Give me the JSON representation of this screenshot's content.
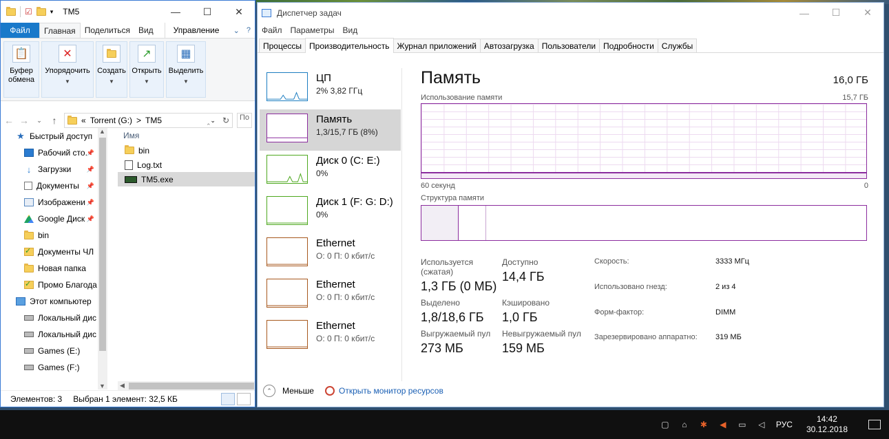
{
  "explorer": {
    "title": "TM5",
    "tabs": {
      "file": "Файл",
      "home": "Главная",
      "share": "Поделиться",
      "view": "Вид",
      "manage": "Управление"
    },
    "ribbon": {
      "clipboard": "Буфер обмена",
      "organize": "Упорядочить",
      "create": "Создать",
      "open": "Открыть",
      "select": "Выделить"
    },
    "address": {
      "prefix": "«",
      "drive": "Torrent (G:)",
      "sep": ">",
      "folder": "TM5",
      "search_placeholder": "По"
    },
    "nav": [
      {
        "label": "Быстрый доступ",
        "icon": "star-icon",
        "pinned": false
      },
      {
        "label": "Рабочий сто.",
        "icon": "desktop-icon",
        "pinned": true
      },
      {
        "label": "Загрузки",
        "icon": "download-icon",
        "pinned": true
      },
      {
        "label": "Документы",
        "icon": "documents-icon",
        "pinned": true
      },
      {
        "label": "Изображени",
        "icon": "pictures-icon",
        "pinned": true
      },
      {
        "label": "Google Диск",
        "icon": "google-drive-icon",
        "pinned": true
      },
      {
        "label": "bin",
        "icon": "folder-icon",
        "pinned": false
      },
      {
        "label": "Документы ЧЛ",
        "icon": "folder-check-icon",
        "pinned": false
      },
      {
        "label": "Новая папка",
        "icon": "folder-icon",
        "pinned": false
      },
      {
        "label": "Промо Благода",
        "icon": "folder-check-icon",
        "pinned": false
      },
      {
        "label": "Этот компьютер",
        "icon": "computer-icon",
        "pinned": false
      },
      {
        "label": "Локальный дис",
        "icon": "drive-icon",
        "pinned": false
      },
      {
        "label": "Локальный дис",
        "icon": "drive-icon",
        "pinned": false
      },
      {
        "label": "Games (E:)",
        "icon": "drive-icon",
        "pinned": false
      },
      {
        "label": "Games (F:)",
        "icon": "drive-icon",
        "pinned": false
      }
    ],
    "column_name": "Имя",
    "files": [
      {
        "name": "bin",
        "type": "folder",
        "selected": false
      },
      {
        "name": "Log.txt",
        "type": "txt",
        "selected": false
      },
      {
        "name": "TM5.exe",
        "type": "exe",
        "selected": true
      }
    ],
    "status": {
      "count": "Элементов: 3",
      "selection": "Выбран 1 элемент: 32,5 КБ"
    }
  },
  "taskmgr": {
    "title": "Диспетчер задач",
    "menu": [
      "Файл",
      "Параметры",
      "Вид"
    ],
    "tabs": [
      "Процессы",
      "Производительность",
      "Журнал приложений",
      "Автозагрузка",
      "Пользователи",
      "Подробности",
      "Службы"
    ],
    "active_tab": "Производительность",
    "resources": [
      {
        "name": "ЦП",
        "sub": "2% 3,82 ГГц",
        "color": "#1c7dc1"
      },
      {
        "name": "Память",
        "sub": "1,3/15,7 ГБ (8%)",
        "color": "#8b2c9e"
      },
      {
        "name": "Диск 0 (C: E:)",
        "sub": "0%",
        "color": "#4da81e"
      },
      {
        "name": "Диск 1 (F: G: D:)",
        "sub": "0%",
        "color": "#4da81e"
      },
      {
        "name": "Ethernet",
        "sub": "О: 0 П: 0 кбит/с",
        "color": "#a7581d"
      },
      {
        "name": "Ethernet",
        "sub": "О: 0 П: 0 кбит/с",
        "color": "#a7581d"
      },
      {
        "name": "Ethernet",
        "sub": "О: 0 П: 0 кбит/с",
        "color": "#a7581d"
      }
    ],
    "memory": {
      "title": "Память",
      "total": "16,0 ГБ",
      "usage_caption": "Использование памяти",
      "usage_max": "15,7 ГБ",
      "usage_fraction": 0.08,
      "axis_left": "60 секунд",
      "axis_right": "0",
      "structure_caption": "Структура памяти",
      "stats": {
        "in_use_label": "Используется (сжатая)",
        "in_use": "1,3 ГБ (0 МБ)",
        "available_label": "Доступно",
        "available": "14,4 ГБ",
        "committed_label": "Выделено",
        "committed": "1,8/18,6 ГБ",
        "cached_label": "Кэшировано",
        "cached": "1,0 ГБ",
        "paged_label": "Выгружаемый пул",
        "paged": "273 МБ",
        "nonpaged_label": "Невыгружаемый пул",
        "nonpaged": "159 МБ"
      },
      "details": [
        {
          "k": "Скорость:",
          "v": "3333 МГц"
        },
        {
          "k": "Использовано гнезд:",
          "v": "2 из 4"
        },
        {
          "k": "Форм-фактор:",
          "v": "DIMM"
        },
        {
          "k": "Зарезервировано аппаратно:",
          "v": "319 МБ"
        }
      ]
    },
    "footer": {
      "less": "Меньше",
      "monitor": "Открыть монитор ресурсов"
    }
  },
  "taskbar": {
    "lang": "РУС",
    "time": "14:42",
    "date": "30.12.2018"
  }
}
